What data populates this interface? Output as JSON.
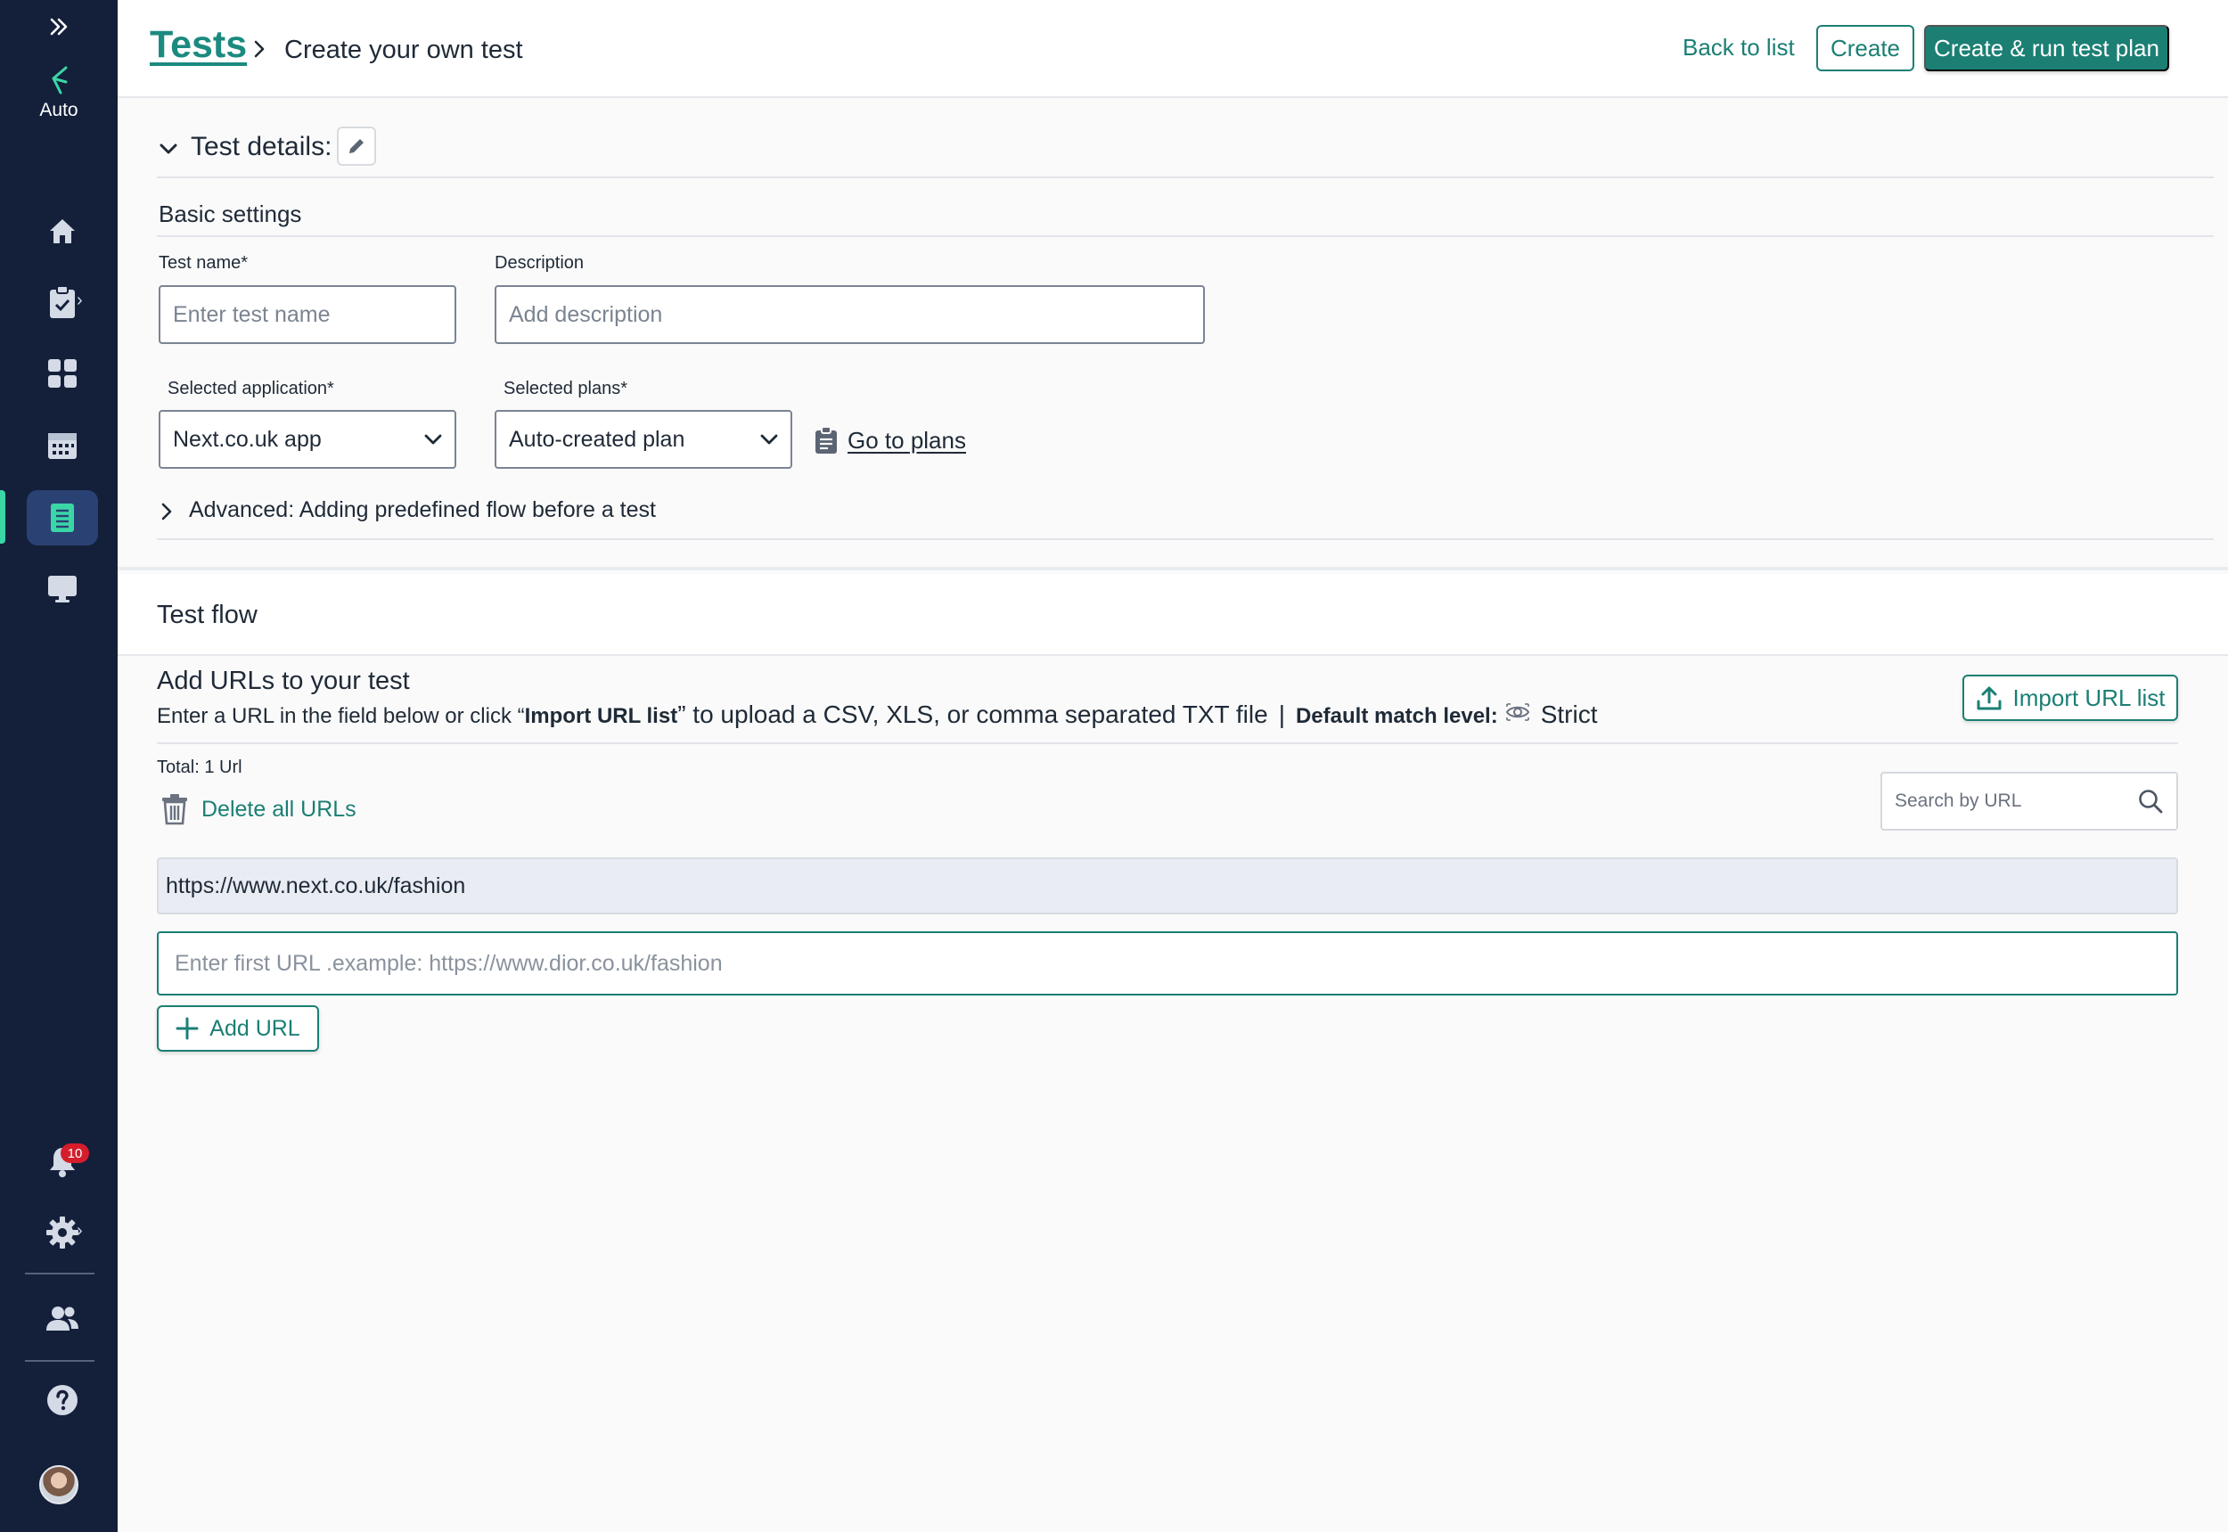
{
  "sidebar": {
    "logo_label": "Auto",
    "notification_count": "10",
    "items": [
      {
        "name": "home-icon"
      },
      {
        "name": "clipboard-check-icon"
      },
      {
        "name": "dashboard-grid-icon"
      },
      {
        "name": "calendar-icon"
      },
      {
        "name": "list-document-icon"
      },
      {
        "name": "monitor-icon"
      }
    ],
    "accent_color": "#3ad6a6",
    "background_color": "#14203a"
  },
  "header": {
    "breadcrumb_root": "Tests",
    "breadcrumb_current": "Create your own test",
    "back_label": "Back to list",
    "create_label": "Create",
    "create_run_label": "Create & run test plan",
    "brand_color": "#1b7f74"
  },
  "details": {
    "title": "Test details:",
    "basic_settings": "Basic settings",
    "test_name": {
      "label": "Test name*",
      "placeholder": "Enter test name"
    },
    "description": {
      "label": "Description",
      "placeholder": "Add description"
    },
    "application": {
      "label": "Selected application*",
      "value": "Next.co.uk app"
    },
    "plans": {
      "label": "Selected plans*",
      "value": "Auto-created plan"
    },
    "go_to_plans": "Go to plans",
    "advanced": "Advanced: Adding predefined flow before a test"
  },
  "flow": {
    "title": "Test flow",
    "add_title": "Add  URLs to your test",
    "desc_part1": "Enter a URL in the field below  or click “",
    "desc_import": "Import URL list",
    "desc_part2": "”  to upload a CSV, XLS, or comma separated TXT file",
    "match_level_label": "Default match level:",
    "match_level_value": "Strict",
    "import_label": "Import URL list",
    "total": "Total: 1 Url",
    "delete_all": "Delete all URLs",
    "search_placeholder": "Search by URL",
    "urls": [
      "https://www.next.co.uk/fashion"
    ],
    "url_input_placeholder": "Enter first URL .example: https://www.dior.co.uk/fashion",
    "add_url_label": "Add URL"
  }
}
